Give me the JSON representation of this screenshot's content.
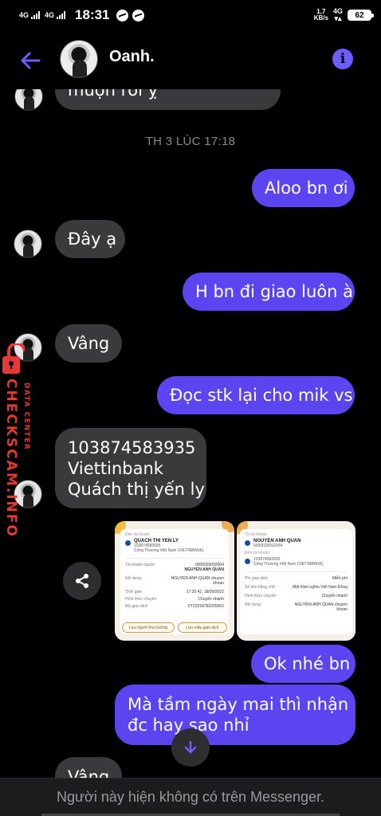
{
  "status_bar": {
    "network_left_1": "4G",
    "network_left_2": "4G",
    "time": "18:31",
    "speed_value": "1,7",
    "speed_unit": "KB/s",
    "network_right": "4G",
    "battery": "62"
  },
  "header": {
    "contact_name": "Oanh.",
    "accent_color": "#6f5cff"
  },
  "messages": [
    {
      "side": "in",
      "text": "muộn rồi ỵ"
    },
    {
      "side": "timestamp",
      "text": "TH 3 LÚC 17:18"
    },
    {
      "side": "out",
      "text": "Aloo bn ơi"
    },
    {
      "side": "in",
      "text": "Đây ạ"
    },
    {
      "side": "out",
      "text": "H bn đi giao luôn à"
    },
    {
      "side": "in",
      "text": "Vâng"
    },
    {
      "side": "out",
      "text": "Đọc stk lại cho mik vs"
    },
    {
      "side": "in",
      "lines": [
        "103874583935",
        "Viettinbank",
        "Quách thị yến ly"
      ]
    },
    {
      "side": "out",
      "text": "Ok nhé bn"
    },
    {
      "side": "out",
      "lines": [
        "Mà tầm ngày mai thì nhận",
        "đc hay sao nhỉ"
      ]
    },
    {
      "side": "in",
      "text": "Vâng"
    }
  ],
  "attachment_1": {
    "to_label": "Đến tài khoản",
    "to_name": "QUACH THI YEN LY",
    "to_account": "103874583935",
    "to_bank": "Công Thương Việt Nam (VIETINBANK)",
    "source_label": "Tài khoản nguồn",
    "source_account": "0000026092004",
    "source_name": "NGUYEN ANH QUAN",
    "content_label": "Nội dung",
    "content_value": "NGUYEN ANH QUAN chuyen khoan",
    "time_label": "Thời gian",
    "time_value": "17:20:42, 18/09/2022",
    "method_label": "Hình thức chuyển",
    "method_value": "Chuyển nhanh",
    "code_label": "Mã giao dịch",
    "code_value": "FT22018782205662",
    "button_1": "Lưu người thụ hưởng",
    "button_2": "Lưu mẫu giao dịch"
  },
  "attachment_2": {
    "from_label": "Từ tài khoản",
    "from_name": "NGUYEN ANH QUAN",
    "from_account": "0000026092004",
    "to_label": "Đến tài khoản",
    "to_account": "103874583935",
    "to_bank": "Công Thương Việt Nam (VIETINBANK)",
    "fee_label": "Phí giao dịch",
    "fee_value": "Miễn phí",
    "words_label": "Số tiền bằng chữ",
    "words_value": "Một trăm nghìn Việt Nam Đồng",
    "method_label": "Hình thức chuyển",
    "method_value": "Chuyển nhanh",
    "content_label": "Nội dung",
    "content_value": "NGUYEN ANH QUAN chuyen khoan"
  },
  "watermark": {
    "main": "CHECKSCAM.INFO",
    "sub": "DATA CENTER"
  },
  "footer": {
    "text": "Người này hiện không có trên Messenger."
  }
}
